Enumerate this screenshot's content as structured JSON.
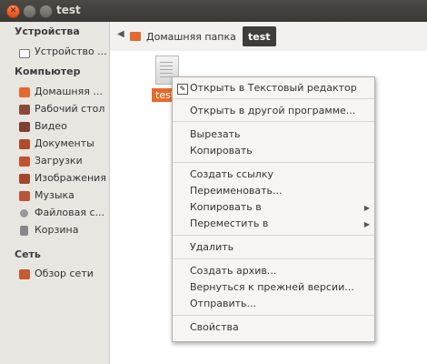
{
  "window": {
    "title": "test"
  },
  "sidebar": {
    "sections": [
      {
        "header": "Устройства",
        "items": [
          {
            "label": "Устройство ...",
            "icon": "drive-icon"
          }
        ]
      },
      {
        "header": "Компьютер",
        "items": [
          {
            "label": "Домашняя ...",
            "icon": "home-folder-icon"
          },
          {
            "label": "Рабочий стол",
            "icon": "desktop-icon"
          },
          {
            "label": "Видео",
            "icon": "video-icon"
          },
          {
            "label": "Документы",
            "icon": "documents-icon"
          },
          {
            "label": "Загрузки",
            "icon": "downloads-icon"
          },
          {
            "label": "Изображения",
            "icon": "pictures-icon"
          },
          {
            "label": "Музыка",
            "icon": "music-icon"
          },
          {
            "label": "Файловая с...",
            "icon": "filesystem-icon"
          },
          {
            "label": "Корзина",
            "icon": "trash-icon"
          }
        ]
      },
      {
        "header": "Сеть",
        "items": [
          {
            "label": "Обзор сети",
            "icon": "network-icon"
          }
        ]
      }
    ]
  },
  "pathbar": {
    "home_label": "Домашняя папка",
    "current_label": "test"
  },
  "content": {
    "file_name": "test"
  },
  "context_menu": {
    "items": [
      {
        "label": "Открыть в Текстовый редактор"
      },
      {
        "label": "Открыть в другой программе..."
      },
      {
        "label": "Вырезать"
      },
      {
        "label": "Копировать"
      },
      {
        "label": "Создать ссылку"
      },
      {
        "label": "Переименовать..."
      },
      {
        "label": "Копировать в",
        "submenu": true
      },
      {
        "label": "Переместить в",
        "submenu": true
      },
      {
        "label": "Удалить"
      },
      {
        "label": "Создать архив..."
      },
      {
        "label": "Вернуться к прежней версии..."
      },
      {
        "label": "Отправить..."
      },
      {
        "label": "Свойства"
      }
    ]
  },
  "colors": {
    "accent": "#e66a2b",
    "titlebar": "#3c3b37",
    "sidebar_bg": "#e8e6e1"
  }
}
